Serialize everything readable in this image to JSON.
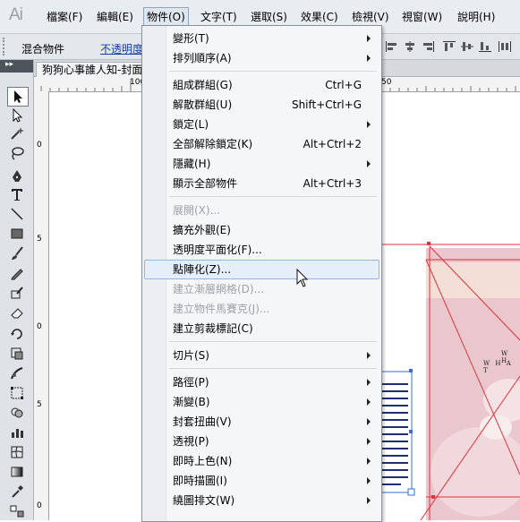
{
  "app": {
    "logo": "Ai"
  },
  "menubar": {
    "items": [
      "檔案(F)",
      "編輯(E)",
      "物件(O)",
      "文字(T)",
      "選取(S)",
      "效果(C)",
      "檢視(V)",
      "視窗(W)",
      "說明(H)"
    ],
    "active": "物件(O)"
  },
  "control_bar": {
    "blend_label": "混合物件",
    "opacity_link": "不透明度"
  },
  "document": {
    "tab_title": "狗狗心事誰人知-封面"
  },
  "rulers": {
    "h_marks": [
      "100",
      "50"
    ],
    "v_marks": [
      "0",
      "5",
      "0",
      "5",
      "0"
    ]
  },
  "object_menu": {
    "items": [
      {
        "label": "變形(T)",
        "shortcut": "",
        "submenu": true,
        "disabled": false
      },
      {
        "label": "排列順序(A)",
        "shortcut": "",
        "submenu": true,
        "disabled": false
      },
      {
        "label": "組成群組(G)",
        "shortcut": "Ctrl+G",
        "submenu": false,
        "disabled": false
      },
      {
        "label": "解散群組(U)",
        "shortcut": "Shift+Ctrl+G",
        "submenu": false,
        "disabled": false
      },
      {
        "label": "鎖定(L)",
        "shortcut": "",
        "submenu": true,
        "disabled": false
      },
      {
        "label": "全部解除鎖定(K)",
        "shortcut": "Alt+Ctrl+2",
        "submenu": false,
        "disabled": false
      },
      {
        "label": "隱藏(H)",
        "shortcut": "",
        "submenu": true,
        "disabled": false
      },
      {
        "label": "顯示全部物件",
        "shortcut": "Alt+Ctrl+3",
        "submenu": false,
        "disabled": false
      },
      {
        "label": "展開(X)...",
        "shortcut": "",
        "submenu": false,
        "disabled": true
      },
      {
        "label": "擴充外觀(E)",
        "shortcut": "",
        "submenu": false,
        "disabled": false
      },
      {
        "label": "透明度平面化(F)...",
        "shortcut": "",
        "submenu": false,
        "disabled": false
      },
      {
        "label": "點陣化(Z)...",
        "shortcut": "",
        "submenu": false,
        "disabled": false,
        "highlighted": true
      },
      {
        "label": "建立漸層網格(D)...",
        "shortcut": "",
        "submenu": false,
        "disabled": true
      },
      {
        "label": "建立物件馬賽克(J)...",
        "shortcut": "",
        "submenu": false,
        "disabled": true
      },
      {
        "label": "建立剪裁標記(C)",
        "shortcut": "",
        "submenu": false,
        "disabled": false
      },
      {
        "label": "切片(S)",
        "shortcut": "",
        "submenu": true,
        "disabled": false
      },
      {
        "label": "路徑(P)",
        "shortcut": "",
        "submenu": true,
        "disabled": false
      },
      {
        "label": "漸變(B)",
        "shortcut": "",
        "submenu": true,
        "disabled": false
      },
      {
        "label": "封套扭曲(V)",
        "shortcut": "",
        "submenu": true,
        "disabled": false
      },
      {
        "label": "透視(P)",
        "shortcut": "",
        "submenu": true,
        "disabled": false
      },
      {
        "label": "即時上色(N)",
        "shortcut": "",
        "submenu": true,
        "disabled": false
      },
      {
        "label": "即時描圖(I)",
        "shortcut": "",
        "submenu": true,
        "disabled": false
      },
      {
        "label": "繞圖排文(W)",
        "shortcut": "",
        "submenu": true,
        "disabled": false
      }
    ]
  },
  "artwork": {
    "text1": "W H",
    "text2": "W H A T"
  },
  "colors": {
    "accent_red": "#e0323c",
    "selection_blue": "#3a6bd6",
    "highlight": "#e6eefa"
  }
}
